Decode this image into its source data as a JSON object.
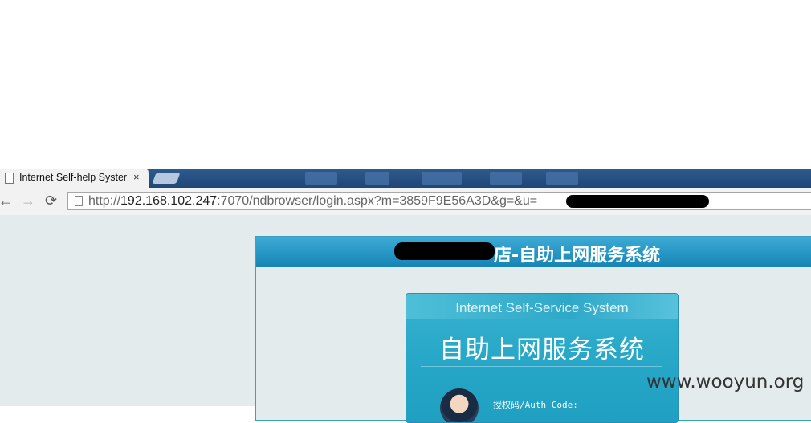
{
  "browser": {
    "tab_title": "Internet Self-help Syster",
    "tab_close": "×",
    "back_glyph": "←",
    "forward_glyph": "→",
    "reload_glyph": "⟳",
    "url_scheme": "http://",
    "url_host": "192.168.102.247",
    "url_path": ":7070/ndbrowser/login.aspx?m=3859F9E56A3D&g=&u="
  },
  "page": {
    "header_title": "店-自助上网服务系统",
    "login": {
      "subtitle_en": "Internet Self-Service System",
      "title_cn": "自助上网服务系统",
      "auth_label": "授权码/Auth Code:"
    }
  },
  "watermark": "www.wooyun.org",
  "colors": {
    "tab_strip": "#2e5a8e",
    "header_blue": "#1585b6",
    "login_blue": "#2aa9c9",
    "page_bg": "#e3ebec"
  }
}
